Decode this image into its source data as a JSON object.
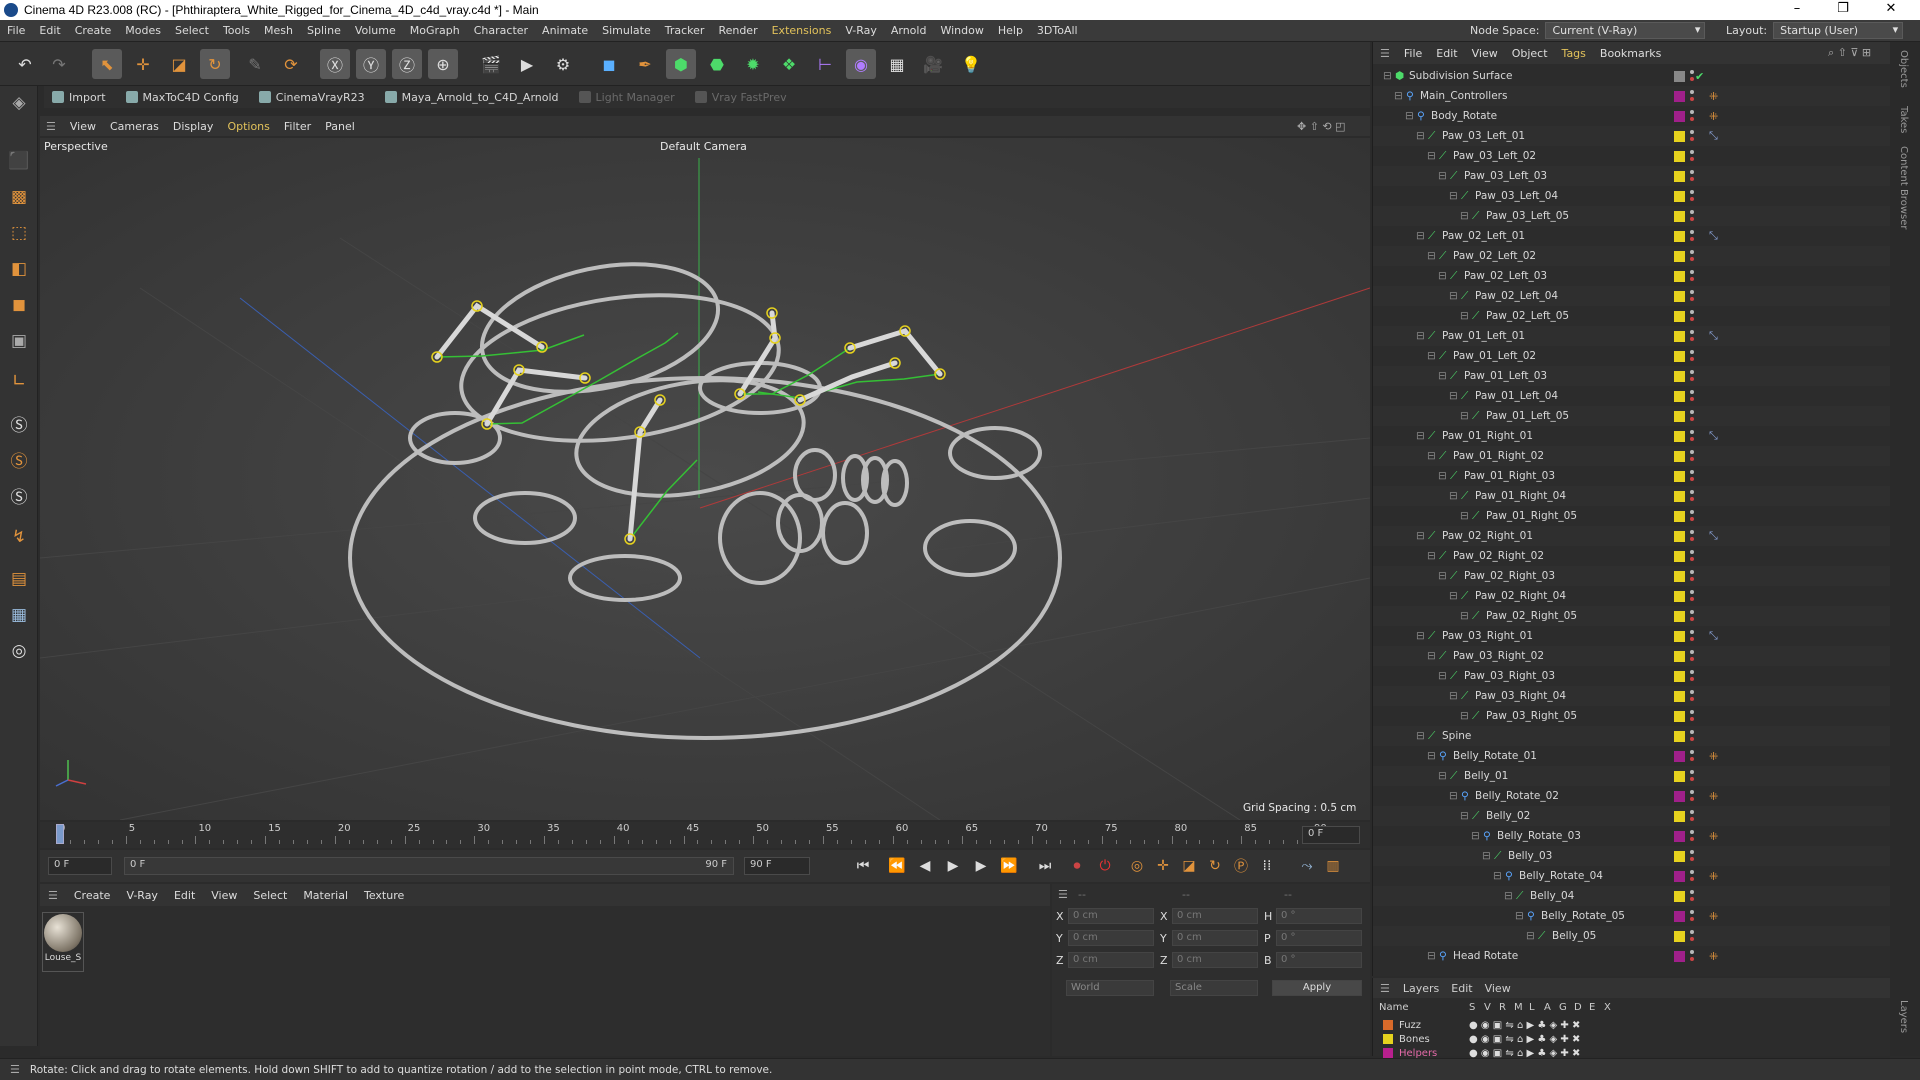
{
  "window": {
    "title": "Cinema 4D R23.008 (RC) - [Phthiraptera_White_Rigged_for_Cinema_4D_c4d_vray.c4d *] - Main",
    "min": "–",
    "max": "❐",
    "close": "✕"
  },
  "menu": {
    "items": [
      "File",
      "Edit",
      "Create",
      "Modes",
      "Select",
      "Tools",
      "Mesh",
      "Spline",
      "Volume",
      "MoGraph",
      "Character",
      "Animate",
      "Simulate",
      "Tracker",
      "Render",
      "Extensions",
      "V-Ray",
      "Arnold",
      "Window",
      "Help",
      "3DToAll"
    ],
    "node_space_label": "Node Space:",
    "node_space_value": "Current (V-Ray)",
    "layout_label": "Layout:",
    "layout_value": "Startup (User)"
  },
  "plugins": {
    "items": [
      "Import",
      "MaxToC4D Config",
      "CinemaVrayR23",
      "Maya_Arnold_to_C4D_Arnold",
      "Light Manager",
      "Vray FastPrev"
    ]
  },
  "viewport": {
    "menu": [
      "View",
      "Cameras",
      "Display",
      "Options",
      "Filter",
      "Panel"
    ],
    "active_menu": "Options",
    "name": "Perspective",
    "camera": "Default Camera",
    "grid_spacing": "Grid Spacing : 0.5 cm"
  },
  "timeline": {
    "ticks": [
      "0",
      "5",
      "10",
      "15",
      "20",
      "25",
      "30",
      "35",
      "40",
      "45",
      "50",
      "55",
      "60",
      "65",
      "70",
      "75",
      "80",
      "85",
      "90"
    ],
    "end_field": "0 F"
  },
  "playback": {
    "current": "0 F",
    "start": "0 F",
    "end": "90 F",
    "end2": "90 F"
  },
  "materials": {
    "menu": [
      "Create",
      "V-Ray",
      "Edit",
      "View",
      "Select",
      "Material",
      "Texture"
    ],
    "material_name": "Louse_S"
  },
  "coords": {
    "header1": "--",
    "header2": "--",
    "header3": "--",
    "rows": [
      {
        "a": "X",
        "va": "0 cm",
        "b": "X",
        "vb": "0 cm",
        "c": "H",
        "vc": "0 °"
      },
      {
        "a": "Y",
        "va": "0 cm",
        "b": "Y",
        "vb": "0 cm",
        "c": "P",
        "vc": "0 °"
      },
      {
        "a": "Z",
        "va": "0 cm",
        "b": "Z",
        "vb": "0 cm",
        "c": "B",
        "vc": "0 °"
      }
    ],
    "world": "World",
    "scale": "Scale",
    "apply": "Apply"
  },
  "status": {
    "text": "Rotate: Click and drag to rotate elements. Hold down SHIFT to add to quantize rotation / add to the selection in point mode, CTRL to remove."
  },
  "objects": {
    "menu": [
      "File",
      "Edit",
      "View",
      "Object",
      "Tags",
      "Bookmarks"
    ],
    "active_menu": "Tags",
    "tree": [
      {
        "name": "Subdivision Surface",
        "depth": 0,
        "type": "subd",
        "color": "#888888",
        "tag": "check"
      },
      {
        "name": "Main_Controllers",
        "depth": 1,
        "type": "null",
        "color": "#a0208a",
        "tag": "orange"
      },
      {
        "name": "Body_Rotate",
        "depth": 2,
        "type": "null",
        "color": "#a0208a",
        "tag": "orange"
      },
      {
        "name": "Paw_03_Left_01",
        "depth": 3,
        "type": "joint",
        "color": "#e6d21e",
        "tag": "ik"
      },
      {
        "name": "Paw_03_Left_02",
        "depth": 4,
        "type": "joint",
        "color": "#e6d21e",
        "tag": ""
      },
      {
        "name": "Paw_03_Left_03",
        "depth": 5,
        "type": "joint",
        "color": "#e6d21e",
        "tag": ""
      },
      {
        "name": "Paw_03_Left_04",
        "depth": 6,
        "type": "joint",
        "color": "#e6d21e",
        "tag": ""
      },
      {
        "name": "Paw_03_Left_05",
        "depth": 7,
        "type": "joint",
        "color": "#e6d21e",
        "tag": ""
      },
      {
        "name": "Paw_02_Left_01",
        "depth": 3,
        "type": "joint",
        "color": "#e6d21e",
        "tag": "ik"
      },
      {
        "name": "Paw_02_Left_02",
        "depth": 4,
        "type": "joint",
        "color": "#e6d21e",
        "tag": ""
      },
      {
        "name": "Paw_02_Left_03",
        "depth": 5,
        "type": "joint",
        "color": "#e6d21e",
        "tag": ""
      },
      {
        "name": "Paw_02_Left_04",
        "depth": 6,
        "type": "joint",
        "color": "#e6d21e",
        "tag": ""
      },
      {
        "name": "Paw_02_Left_05",
        "depth": 7,
        "type": "joint",
        "color": "#e6d21e",
        "tag": ""
      },
      {
        "name": "Paw_01_Left_01",
        "depth": 3,
        "type": "joint",
        "color": "#e6d21e",
        "tag": "ik"
      },
      {
        "name": "Paw_01_Left_02",
        "depth": 4,
        "type": "joint",
        "color": "#e6d21e",
        "tag": ""
      },
      {
        "name": "Paw_01_Left_03",
        "depth": 5,
        "type": "joint",
        "color": "#e6d21e",
        "tag": ""
      },
      {
        "name": "Paw_01_Left_04",
        "depth": 6,
        "type": "joint",
        "color": "#e6d21e",
        "tag": ""
      },
      {
        "name": "Paw_01_Left_05",
        "depth": 7,
        "type": "joint",
        "color": "#e6d21e",
        "tag": ""
      },
      {
        "name": "Paw_01_Right_01",
        "depth": 3,
        "type": "joint",
        "color": "#e6d21e",
        "tag": "ik"
      },
      {
        "name": "Paw_01_Right_02",
        "depth": 4,
        "type": "joint",
        "color": "#e6d21e",
        "tag": ""
      },
      {
        "name": "Paw_01_Right_03",
        "depth": 5,
        "type": "joint",
        "color": "#e6d21e",
        "tag": ""
      },
      {
        "name": "Paw_01_Right_04",
        "depth": 6,
        "type": "joint",
        "color": "#e6d21e",
        "tag": ""
      },
      {
        "name": "Paw_01_Right_05",
        "depth": 7,
        "type": "joint",
        "color": "#e6d21e",
        "tag": ""
      },
      {
        "name": "Paw_02_Right_01",
        "depth": 3,
        "type": "joint",
        "color": "#e6d21e",
        "tag": "ik"
      },
      {
        "name": "Paw_02_Right_02",
        "depth": 4,
        "type": "joint",
        "color": "#e6d21e",
        "tag": ""
      },
      {
        "name": "Paw_02_Right_03",
        "depth": 5,
        "type": "joint",
        "color": "#e6d21e",
        "tag": ""
      },
      {
        "name": "Paw_02_Right_04",
        "depth": 6,
        "type": "joint",
        "color": "#e6d21e",
        "tag": ""
      },
      {
        "name": "Paw_02_Right_05",
        "depth": 7,
        "type": "joint",
        "color": "#e6d21e",
        "tag": ""
      },
      {
        "name": "Paw_03_Right_01",
        "depth": 3,
        "type": "joint",
        "color": "#e6d21e",
        "tag": "ik"
      },
      {
        "name": "Paw_03_Right_02",
        "depth": 4,
        "type": "joint",
        "color": "#e6d21e",
        "tag": ""
      },
      {
        "name": "Paw_03_Right_03",
        "depth": 5,
        "type": "joint",
        "color": "#e6d21e",
        "tag": ""
      },
      {
        "name": "Paw_03_Right_04",
        "depth": 6,
        "type": "joint",
        "color": "#e6d21e",
        "tag": ""
      },
      {
        "name": "Paw_03_Right_05",
        "depth": 7,
        "type": "joint",
        "color": "#e6d21e",
        "tag": ""
      },
      {
        "name": "Spine",
        "depth": 3,
        "type": "joint",
        "color": "#e6d21e",
        "tag": ""
      },
      {
        "name": "Belly_Rotate_01",
        "depth": 4,
        "type": "null",
        "color": "#a0208a",
        "tag": "orange"
      },
      {
        "name": "Belly_01",
        "depth": 5,
        "type": "joint",
        "color": "#e6d21e",
        "tag": ""
      },
      {
        "name": "Belly_Rotate_02",
        "depth": 6,
        "type": "null",
        "color": "#a0208a",
        "tag": "orange"
      },
      {
        "name": "Belly_02",
        "depth": 7,
        "type": "joint",
        "color": "#e6d21e",
        "tag": ""
      },
      {
        "name": "Belly_Rotate_03",
        "depth": 8,
        "type": "null",
        "color": "#a0208a",
        "tag": "orange"
      },
      {
        "name": "Belly_03",
        "depth": 9,
        "type": "joint",
        "color": "#e6d21e",
        "tag": ""
      },
      {
        "name": "Belly_Rotate_04",
        "depth": 10,
        "type": "null",
        "color": "#a0208a",
        "tag": "orange"
      },
      {
        "name": "Belly_04",
        "depth": 11,
        "type": "joint",
        "color": "#e6d21e",
        "tag": ""
      },
      {
        "name": "Belly_Rotate_05",
        "depth": 12,
        "type": "null",
        "color": "#a0208a",
        "tag": "orange"
      },
      {
        "name": "Belly_05",
        "depth": 13,
        "type": "joint",
        "color": "#e6d21e",
        "tag": ""
      },
      {
        "name": "Head Rotate",
        "depth": 4,
        "type": "null",
        "color": "#a0208a",
        "tag": "orange"
      }
    ]
  },
  "layers": {
    "menu": [
      "Layers",
      "Edit",
      "View"
    ],
    "col_name": "Name",
    "cols": [
      "S",
      "V",
      "R",
      "M",
      "L",
      "A",
      "G",
      "D",
      "E",
      "X"
    ],
    "items": [
      {
        "name": "Fuzz",
        "color": "#d86a2a"
      },
      {
        "name": "Bones",
        "color": "#e6d21e"
      },
      {
        "name": "Helpers",
        "color": "#b8208e"
      }
    ]
  },
  "side_tabs": [
    "Objects",
    "Takes",
    "Content Browser",
    "Layers"
  ],
  "colors": {
    "accent": "#e2c25b",
    "joint": "#e6d21e",
    "null": "#a0208a",
    "bone_line": "#35c035"
  }
}
